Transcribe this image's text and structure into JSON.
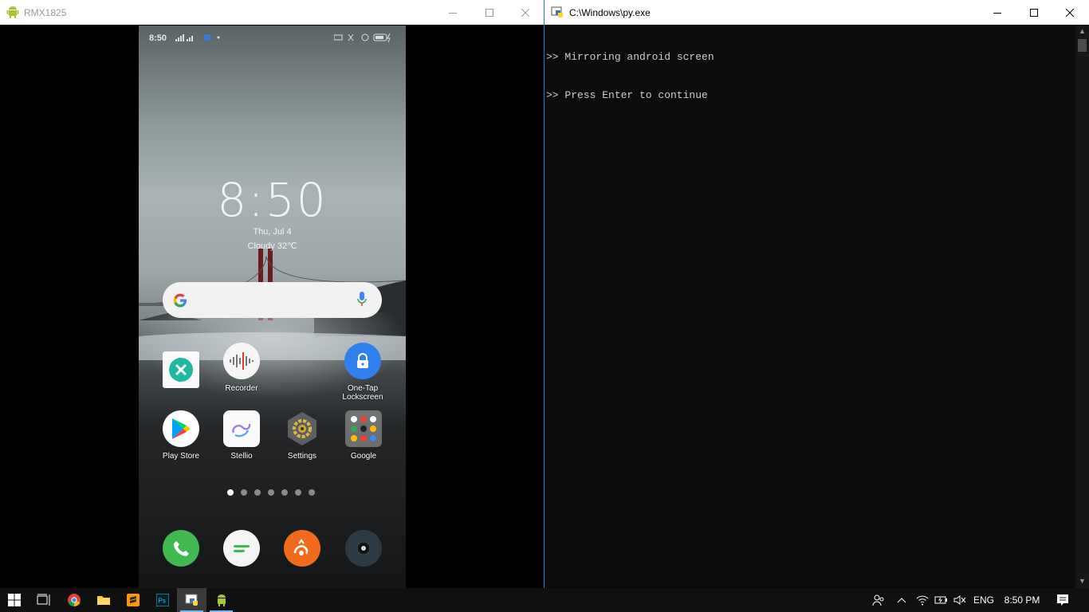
{
  "left_window": {
    "title": "RMX1825"
  },
  "right_window": {
    "title": "C:\\Windows\\py.exe",
    "console_lines": [
      ">> Mirroring android screen",
      ">> Press Enter to continue"
    ]
  },
  "phone": {
    "status_time": "8:50",
    "clock": "8:50",
    "date": "Thu, Jul 4",
    "weather": "Cloudy 32℃",
    "apps_row1": [
      {
        "label": ""
      },
      {
        "label": "Recorder"
      },
      {
        "label": "One-Tap Lockscreen"
      }
    ],
    "apps_row2": [
      {
        "label": "Play Store"
      },
      {
        "label": "Stellio"
      },
      {
        "label": "Settings"
      },
      {
        "label": "Google"
      }
    ],
    "page_count": 7,
    "active_page": 1
  },
  "taskbar": {
    "language": "ENG",
    "time": "8:50 PM"
  },
  "colors": {
    "accent": "#2c7bd8",
    "console_bg": "#0c0c0c",
    "taskbar_bg": "#101010"
  }
}
